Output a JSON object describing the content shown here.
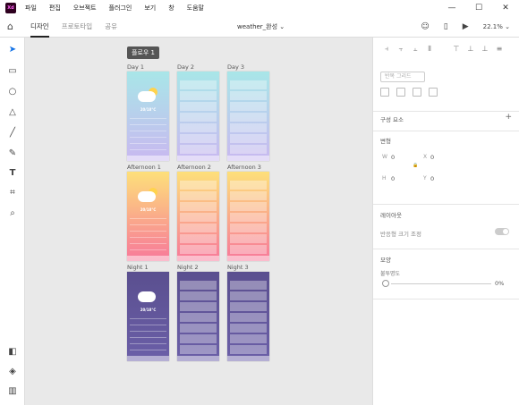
{
  "app": {
    "logo": "Xd",
    "menu": [
      "파일",
      "편집",
      "오브젝트",
      "플러그인",
      "보기",
      "창",
      "도움말"
    ],
    "window_controls": [
      "—",
      "☐",
      "✕"
    ]
  },
  "tabs": {
    "items": [
      "디자인",
      "프로토타입",
      "공유"
    ],
    "active": "디자인",
    "doc_title": "weather_완성 ⌄",
    "zoom": "22.1% ⌄"
  },
  "canvas": {
    "flow_label": "플로우 1",
    "artboards": [
      {
        "label": "Day 1",
        "theme": "day",
        "has_hero": true
      },
      {
        "label": "Day 2",
        "theme": "day",
        "has_hero": false
      },
      {
        "label": "Day 3",
        "theme": "day",
        "has_hero": false
      },
      {
        "label": "Afternoon 1",
        "theme": "afternoon",
        "has_hero": true
      },
      {
        "label": "Afternoon 2",
        "theme": "afternoon",
        "has_hero": false
      },
      {
        "label": "Afternoon 3",
        "theme": "afternoon",
        "has_hero": false
      },
      {
        "label": "Night 1",
        "theme": "night",
        "has_hero": true
      },
      {
        "label": "Night 2",
        "theme": "night",
        "has_hero": false
      },
      {
        "label": "Night 3",
        "theme": "night",
        "has_hero": false
      }
    ],
    "hero_temp": "20/18°C",
    "hero_city": "Seoul, Korea",
    "colors": {
      "day_top": "#a8e6e8",
      "day_bottom": "#c9b8f0",
      "afternoon_top": "#fde07a",
      "afternoon_bottom": "#f7789a",
      "night_top": "#5a4f8f",
      "night_bottom": "#6b5fa8"
    }
  },
  "properties": {
    "repeat_grid": "반복 그리드",
    "component": "구성 요소",
    "transform": "변형",
    "w_label": "W",
    "w_value": "0",
    "x_label": "X",
    "x_value": "0",
    "h_label": "H",
    "h_value": "0",
    "y_label": "Y",
    "y_value": "0",
    "layout": "레이아웃",
    "responsive_resize": "반응형 크기 조정",
    "appearance": "모양",
    "opacity_label": "불투명도",
    "opacity_value": "0%"
  }
}
